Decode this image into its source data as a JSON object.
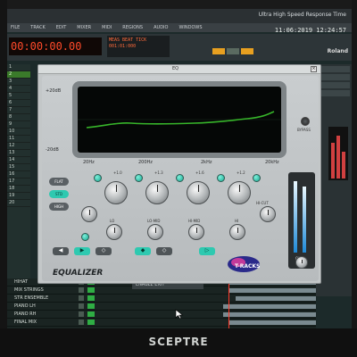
{
  "daw": {
    "status_text": "Ultra High Speed Response Time",
    "clock": "11:06:2019  12:24:57",
    "menu": [
      "FILE",
      "TRACK",
      "EDIT",
      "MIXER",
      "MIDI",
      "REGIONS",
      "AUDIO",
      "WINDOWS"
    ],
    "counter": "00:00:00.00",
    "counter2_lines": [
      "MEAS BEAT TICK",
      "001:01:000"
    ],
    "right_brand": "Roland",
    "tracks_left": [
      "1",
      "2",
      "3",
      "4",
      "5",
      "6",
      "7",
      "8",
      "9",
      "10",
      "11",
      "12",
      "13",
      "14",
      "15",
      "16",
      "17",
      "18",
      "19",
      "20"
    ],
    "bottom_tracks": [
      {
        "label": "HIHAT",
        "clip_start": 0.72,
        "clip_end": 1.0
      },
      {
        "label": "MIX STRINGS",
        "clip_start": 0.72,
        "clip_end": 1.0
      },
      {
        "label": "STR ENSEMBLE",
        "clip_start": 0.74,
        "clip_end": 1.0
      },
      {
        "label": "PIANO LH",
        "clip_start": 0.7,
        "clip_end": 1.0
      },
      {
        "label": "PIANO RH",
        "clip_start": 0.7,
        "clip_end": 1.0
      },
      {
        "label": "FINAL MIX",
        "clip_start": 0.72,
        "clip_end": 1.0
      }
    ],
    "bottom_status": "ENABLE   EXIT"
  },
  "plugin": {
    "window_title": "EQ",
    "close_glyph": "×",
    "graph_labels": {
      "top_left": "+20dB",
      "bottom_left": "-20dB"
    },
    "freq_labels": [
      "20Hz",
      "200Hz",
      "2kHz",
      "20kHz"
    ],
    "bypass_label": "BYPASS",
    "mode_buttons": [
      {
        "label": "FLAT",
        "on": false
      },
      {
        "label": "STD",
        "on": true
      },
      {
        "label": "HIGH",
        "on": false
      }
    ],
    "band_gain_labels": [
      "+1.0",
      "+1.3",
      "+1.6",
      "+1.2"
    ],
    "band_freq_labels": [
      "LO",
      "LO-MID",
      "HI-MID",
      "HI",
      "HI-CUT"
    ],
    "shape_glyphs": [
      "◀",
      "▶",
      "◇",
      "◆",
      "◇",
      "▷"
    ],
    "name": "EQUALIZER",
    "logo_text": "T-RACKS",
    "meter_label": "OUT",
    "colors": {
      "accent": "#2ec9b0",
      "curve": "#37b52a"
    }
  },
  "monitor": {
    "brand": "SCEPTRE"
  }
}
